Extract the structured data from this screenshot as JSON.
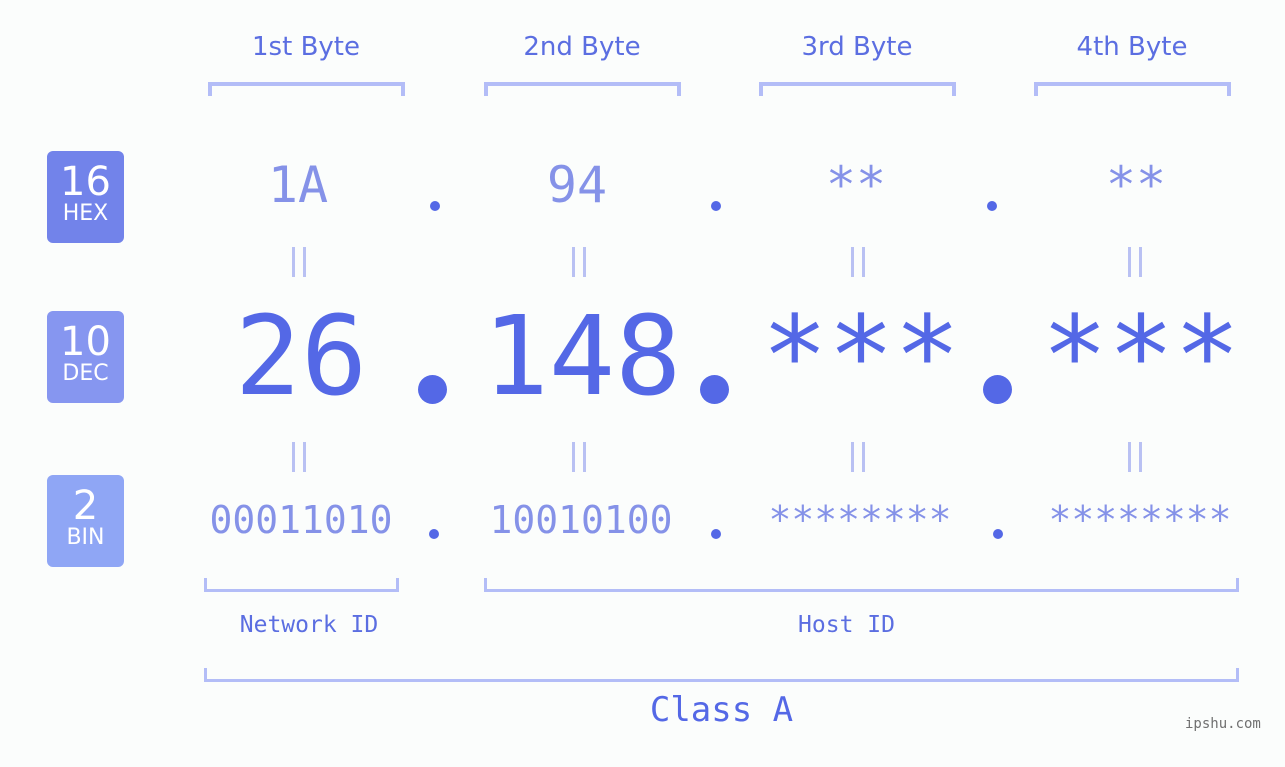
{
  "byte_headers": [
    "1st Byte",
    "2nd Byte",
    "3rd Byte",
    "4th Byte"
  ],
  "bases": {
    "hex": {
      "number": "16",
      "name": "HEX",
      "color": "#7283ea"
    },
    "dec": {
      "number": "10",
      "name": "DEC",
      "color": "#8696f0"
    },
    "bin": {
      "number": "2",
      "name": "BIN",
      "color": "#8fa6f5"
    }
  },
  "hex_octets": [
    "1A",
    "94",
    "**",
    "**"
  ],
  "dec_octets": [
    "26",
    "148",
    "***",
    "***"
  ],
  "bin_octets": [
    "00011010",
    "10010100",
    "********",
    "********"
  ],
  "separator": ".",
  "equals_symbol": "||",
  "network_id_label": "Network ID",
  "host_id_label": "Host ID",
  "class_label": "Class A",
  "watermark": "ipshu.com",
  "colors": {
    "accent": "#5468e6",
    "light_text": "#8592e8",
    "bracket": "#b3bdf7",
    "background": "#fbfdfc"
  }
}
